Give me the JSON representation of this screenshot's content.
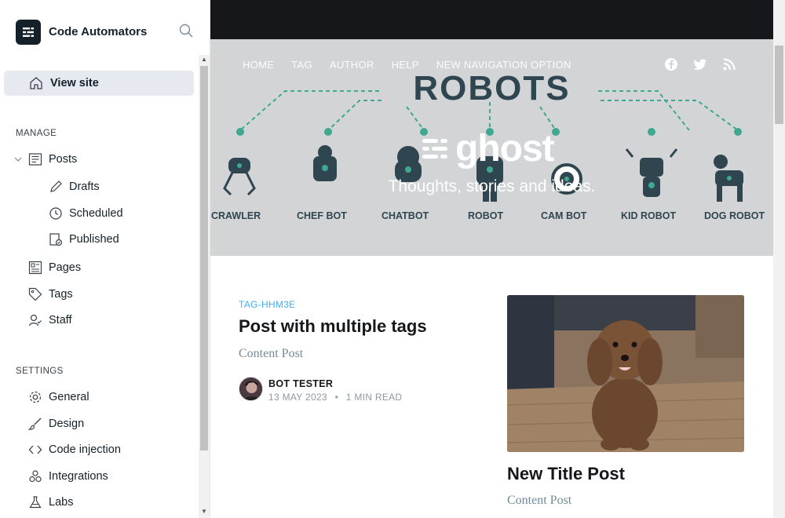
{
  "sidebar": {
    "brand_name": "Code Automators",
    "view_site": "View site",
    "manage_label": "MANAGE",
    "settings_label": "SETTINGS",
    "posts": "Posts",
    "drafts": "Drafts",
    "scheduled": "Scheduled",
    "published": "Published",
    "pages": "Pages",
    "tags": "Tags",
    "staff": "Staff",
    "general": "General",
    "design": "Design",
    "code_injection": "Code injection",
    "integrations": "Integrations",
    "labs": "Labs"
  },
  "site": {
    "nav": [
      "HOME",
      "TAG",
      "AUTHOR",
      "HELP",
      "NEW NAVIGATION OPTION"
    ],
    "hero_title": "ROBOTS",
    "robots": [
      "CRAWLER",
      "CHEF BOT",
      "CHATBOT",
      "ROBOT",
      "CAM BOT",
      "KID ROBOT",
      "DOG ROBOT"
    ],
    "logo_text": "ghost",
    "tagline": "Thoughts, stories and ideas."
  },
  "post1": {
    "tag": "TAG-HHM3E",
    "title": "Post with multiple tags",
    "excerpt": "Content Post",
    "author": "BOT TESTER",
    "date": "13 MAY 2023",
    "separator": "•",
    "read_time": "1 MIN READ"
  },
  "post2": {
    "title": "New Title Post",
    "excerpt": "Content Post"
  },
  "colors": {
    "accent": "#3eb0ef",
    "dark": "#15212a",
    "hero_bg": "#d2d4d6",
    "teal": "#3fa88f"
  }
}
